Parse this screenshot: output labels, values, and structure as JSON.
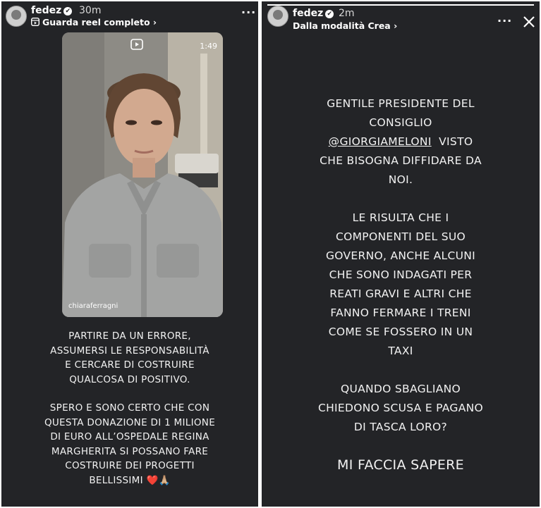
{
  "left_story": {
    "username": "fedez",
    "verified": "✔",
    "time": "30m",
    "subtitle": "Guarda reel completo ›",
    "menu": "···",
    "video": {
      "duration": "1:49",
      "watermark": "chiaraferragni"
    },
    "caption": {
      "para1": [
        "PARTIRE DA UN ERRORE,",
        "ASSUMERSI LE RESPONSABILITÀ",
        "E CERCARE DI COSTRUIRE",
        "QUALCOSA DI POSITIVO."
      ],
      "para2": [
        "SPERO E SONO CERTO CHE CON",
        "QUESTA DONAZIONE DI 1 MILIONE",
        "DI EURO ALL’OSPEDALE REGINA",
        "MARGHERITA SI POSSANO FARE",
        "COSTRUIRE DEI PROGETTI",
        "BELLISSIMI ❤️🙏🏼"
      ]
    }
  },
  "right_story": {
    "username": "fedez",
    "verified": "✔",
    "time": "2m",
    "subtitle": "Dalla modalità Crea ›",
    "menu": "···",
    "text": {
      "p1": [
        "GENTILE PRESIDENTE DEL",
        "CONSIGLIO"
      ],
      "mention": "@GIORGIAMELONI",
      "p1_after_mention": "  VISTO",
      "p1_rest": [
        "CHE BISOGNA DIFFIDARE DA",
        "NOI."
      ],
      "p2": [
        "LE RISULTA CHE I",
        "COMPONENTI DEL SUO",
        "GOVERNO, ANCHE ALCUNI",
        "CHE SONO INDAGATI PER",
        "REATI GRAVI E ALTRI CHE",
        "FANNO FERMARE I TRENI",
        "COME SE FOSSERO IN UN",
        "TAXI"
      ],
      "p3": [
        "QUANDO SBAGLIANO",
        "CHIEDONO SCUSA E PAGANO",
        "DI TASCA LORO?"
      ],
      "closing": "MI FACCIA SAPERE"
    }
  },
  "colors": {
    "background": "#232427",
    "text": "#f2f2f2",
    "divider": "#ffffff"
  }
}
